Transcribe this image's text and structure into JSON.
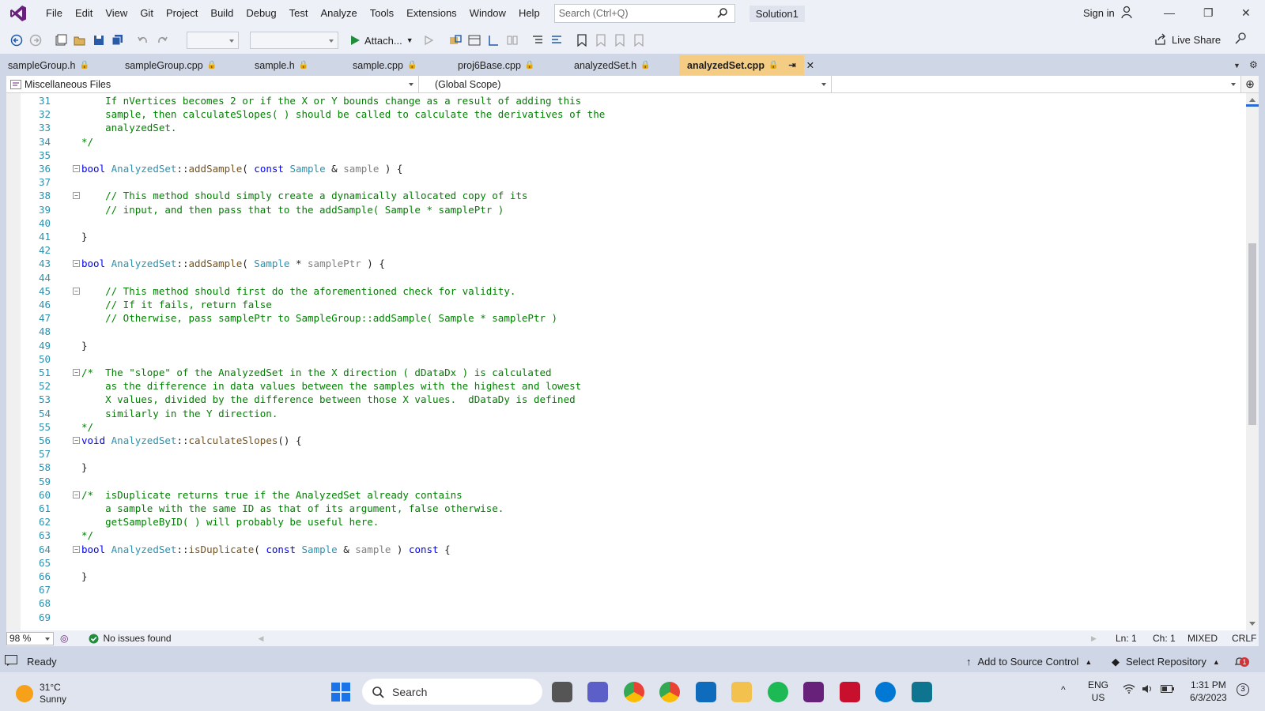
{
  "titlebar": {
    "menu": [
      "File",
      "Edit",
      "View",
      "Git",
      "Project",
      "Build",
      "Debug",
      "Test",
      "Analyze",
      "Tools",
      "Extensions",
      "Window",
      "Help"
    ],
    "search_placeholder": "Search (Ctrl+Q)",
    "solution": "Solution1",
    "sign_in": "Sign in"
  },
  "toolbar": {
    "attach": "Attach...",
    "live_share": "Live Share"
  },
  "tabs": [
    {
      "label": "sampleGroup.h",
      "active": false
    },
    {
      "label": "sampleGroup.cpp",
      "active": false
    },
    {
      "label": "sample.h",
      "active": false
    },
    {
      "label": "sample.cpp",
      "active": false
    },
    {
      "label": "proj6Base.cpp",
      "active": false
    },
    {
      "label": "analyzedSet.h",
      "active": false
    },
    {
      "label": "analyzedSet.cpp",
      "active": true
    }
  ],
  "navbar": {
    "project": "Miscellaneous Files",
    "scope": "(Global Scope)",
    "member": ""
  },
  "code_lines": [
    {
      "n": "31",
      "fold": "",
      "segs": [
        [
          "c",
          "    If nVertices becomes 2 or if the X or Y bounds change as a result of adding this"
        ]
      ]
    },
    {
      "n": "32",
      "fold": "",
      "segs": [
        [
          "c",
          "    sample, then calculateSlopes( ) should be called to calculate the derivatives of the"
        ]
      ]
    },
    {
      "n": "33",
      "fold": "",
      "segs": [
        [
          "c",
          "    analyzedSet."
        ]
      ]
    },
    {
      "n": "34",
      "fold": "",
      "segs": [
        [
          "c",
          "*/"
        ]
      ]
    },
    {
      "n": "35",
      "fold": "",
      "segs": []
    },
    {
      "n": "36",
      "fold": "−",
      "segs": [
        [
          "k",
          "bool "
        ],
        [
          "t",
          "AnalyzedSet"
        ],
        [
          "",
          "::"
        ],
        [
          "f",
          "addSample"
        ],
        [
          "",
          "( "
        ],
        [
          "k",
          "const "
        ],
        [
          "t",
          "Sample"
        ],
        [
          "",
          " & "
        ],
        [
          "p",
          "sample"
        ],
        [
          "",
          " ) {"
        ]
      ]
    },
    {
      "n": "37",
      "fold": "",
      "segs": []
    },
    {
      "n": "38",
      "fold": "−",
      "segs": [
        [
          "c",
          "    // This method should simply create a dynamically allocated copy of its"
        ]
      ]
    },
    {
      "n": "39",
      "fold": "",
      "segs": [
        [
          "c",
          "    // input, and then pass that to the addSample( Sample * samplePtr )"
        ]
      ]
    },
    {
      "n": "40",
      "fold": "",
      "segs": []
    },
    {
      "n": "41",
      "fold": "",
      "segs": [
        [
          "",
          "}"
        ]
      ]
    },
    {
      "n": "42",
      "fold": "",
      "segs": []
    },
    {
      "n": "43",
      "fold": "−",
      "segs": [
        [
          "k",
          "bool "
        ],
        [
          "t",
          "AnalyzedSet"
        ],
        [
          "",
          "::"
        ],
        [
          "f",
          "addSample"
        ],
        [
          "",
          "( "
        ],
        [
          "t",
          "Sample"
        ],
        [
          "",
          " * "
        ],
        [
          "p",
          "samplePtr"
        ],
        [
          "",
          " ) {"
        ]
      ]
    },
    {
      "n": "44",
      "fold": "",
      "segs": []
    },
    {
      "n": "45",
      "fold": "−",
      "segs": [
        [
          "c",
          "    // This method should first do the aforementioned check for validity."
        ]
      ]
    },
    {
      "n": "46",
      "fold": "",
      "segs": [
        [
          "c",
          "    // If it fails, return false"
        ]
      ]
    },
    {
      "n": "47",
      "fold": "",
      "segs": [
        [
          "c",
          "    // Otherwise, pass samplePtr to SampleGroup::addSample( Sample * samplePtr )"
        ]
      ]
    },
    {
      "n": "48",
      "fold": "",
      "segs": []
    },
    {
      "n": "49",
      "fold": "",
      "segs": [
        [
          "",
          "}"
        ]
      ]
    },
    {
      "n": "50",
      "fold": "",
      "segs": []
    },
    {
      "n": "51",
      "fold": "−",
      "segs": [
        [
          "c",
          "/*  The \"slope\" of the AnalyzedSet in the X direction ( dDataDx ) is calculated"
        ]
      ]
    },
    {
      "n": "52",
      "fold": "",
      "segs": [
        [
          "c",
          "    as the difference in data values between the samples with the highest and lowest"
        ]
      ]
    },
    {
      "n": "53",
      "fold": "",
      "segs": [
        [
          "c",
          "    X values, divided by the difference between those X values.  dDataDy is defined"
        ]
      ]
    },
    {
      "n": "54",
      "fold": "",
      "segs": [
        [
          "c",
          "    similarly in the Y direction."
        ]
      ]
    },
    {
      "n": "55",
      "fold": "",
      "segs": [
        [
          "c",
          "*/"
        ]
      ]
    },
    {
      "n": "56",
      "fold": "−",
      "segs": [
        [
          "k",
          "void "
        ],
        [
          "t",
          "AnalyzedSet"
        ],
        [
          "",
          "::"
        ],
        [
          "f",
          "calculateSlopes"
        ],
        [
          "",
          "() {"
        ]
      ]
    },
    {
      "n": "57",
      "fold": "",
      "segs": []
    },
    {
      "n": "58",
      "fold": "",
      "segs": [
        [
          "",
          "}"
        ]
      ]
    },
    {
      "n": "59",
      "fold": "",
      "segs": []
    },
    {
      "n": "60",
      "fold": "−",
      "segs": [
        [
          "c",
          "/*  isDuplicate returns true if the AnalyzedSet already contains"
        ]
      ]
    },
    {
      "n": "61",
      "fold": "",
      "segs": [
        [
          "c",
          "    a sample with the same ID as that of its argument, false otherwise."
        ]
      ]
    },
    {
      "n": "62",
      "fold": "",
      "segs": [
        [
          "c",
          "    getSampleByID( ) will probably be useful here."
        ]
      ]
    },
    {
      "n": "63",
      "fold": "",
      "segs": [
        [
          "c",
          "*/"
        ]
      ]
    },
    {
      "n": "64",
      "fold": "−",
      "segs": [
        [
          "k",
          "bool "
        ],
        [
          "t",
          "AnalyzedSet"
        ],
        [
          "",
          "::"
        ],
        [
          "f",
          "isDuplicate"
        ],
        [
          "",
          "( "
        ],
        [
          "k",
          "const "
        ],
        [
          "t",
          "Sample"
        ],
        [
          "",
          " & "
        ],
        [
          "p",
          "sample"
        ],
        [
          "",
          " ) "
        ],
        [
          "k",
          "const"
        ],
        [
          "",
          " {"
        ]
      ]
    },
    {
      "n": "65",
      "fold": "",
      "segs": []
    },
    {
      "n": "66",
      "fold": "",
      "segs": [
        [
          "",
          "}"
        ]
      ]
    },
    {
      "n": "67",
      "fold": "",
      "segs": []
    },
    {
      "n": "68",
      "fold": "",
      "segs": []
    },
    {
      "n": "69",
      "fold": "",
      "segs": []
    }
  ],
  "editor_status": {
    "zoom": "98 %",
    "issues": "No issues found",
    "ln": "Ln: 1",
    "ch": "Ch: 1",
    "whitespace": "MIXED",
    "eol": "CRLF"
  },
  "statusbar": {
    "ready": "Ready",
    "source_control": "Add to Source Control",
    "repository": "Select Repository",
    "notifications": "1"
  },
  "taskbar": {
    "temperature": "31°C",
    "weather": "Sunny",
    "search": "Search",
    "lang": "ENG",
    "region": "US",
    "time": "1:31 PM",
    "date": "6/3/2023",
    "notif_count": "3"
  },
  "colors": {
    "accent": "#68217a",
    "active_tab": "#f5cc84",
    "comment": "#008000",
    "keyword": "#0000ff",
    "type": "#2b91af"
  }
}
